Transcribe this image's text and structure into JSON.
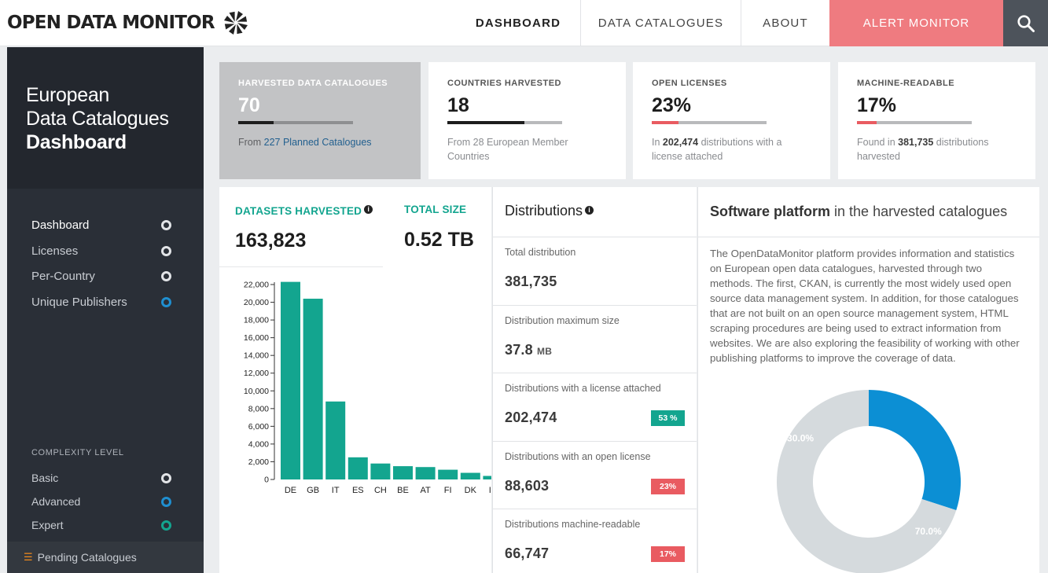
{
  "header": {
    "logo_text": "OPEN DATA MONITOR",
    "nav": [
      {
        "label": "DASHBOARD",
        "active": true
      },
      {
        "label": "DATA CATALOGUES"
      },
      {
        "label": "ABOUT"
      },
      {
        "label": "ALERT MONITOR"
      }
    ],
    "search_icon": "search-icon"
  },
  "sidebar": {
    "title_line1": "European",
    "title_line2": "Data Catalogues",
    "title_line3": "Dashboard",
    "menu": [
      {
        "label": "Dashboard",
        "active": true
      },
      {
        "label": "Licenses"
      },
      {
        "label": "Per-Country"
      },
      {
        "label": "Unique Publishers"
      }
    ],
    "complexity_title": "COMPLEXITY LEVEL",
    "complexity": [
      {
        "label": "Basic"
      },
      {
        "label": "Advanced"
      },
      {
        "label": "Expert"
      }
    ],
    "pending": "Pending Catalogues"
  },
  "kpis": [
    {
      "title": "HARVESTED DATA CATALOGUES",
      "value": "70",
      "progress": 0.31,
      "desc_prefix": "From ",
      "desc_link": "227 Planned Catalogues"
    },
    {
      "title": "COUNTRIES HARVESTED",
      "value": "18",
      "progress": 0.67,
      "desc": "From 28 European Member Countries"
    },
    {
      "title": "OPEN LICENSES",
      "value": "23%",
      "progress": 0.23,
      "desc_prefix": "In ",
      "desc_bold": "202,474",
      "desc_suffix": " distributions with a license attached"
    },
    {
      "title": "MACHINE-READABLE",
      "value": "17%",
      "progress": 0.17,
      "desc_prefix": "Found in ",
      "desc_bold": "381,735",
      "desc_suffix": " distributions harvested"
    }
  ],
  "datasets": {
    "title": "DATASETS HARVESTED",
    "value": "163,823",
    "total_size_title": "TOTAL SIZE",
    "total_size_value": "0.52 TB"
  },
  "distributions": {
    "title": "Distributions",
    "rows": [
      {
        "label": "Total distribution",
        "value": "381,735"
      },
      {
        "label": "Distribution maximum size",
        "value": "37.8",
        "unit": "MB"
      },
      {
        "label": "Distributions with a license attached",
        "value": "202,474",
        "badge": "53 %",
        "badge_color": "#13a58f"
      },
      {
        "label": "Distributions with an open license",
        "value": "88,603",
        "badge": "23%",
        "badge_color": "#e95b61"
      },
      {
        "label": "Distributions machine-readable",
        "value": "66,747",
        "badge": "17%",
        "badge_color": "#e95b61"
      }
    ]
  },
  "software": {
    "title_bold": "Software platform",
    "title_rest": " in the harvested catalogues",
    "text": "The OpenDataMonitor platform provides information and statistics on European open data catalogues, harvested through two methods. The first, CKAN, is currently the most widely used open source data management system. In addition, for those catalogues that are not built on an open source management system, HTML scraping procedures are being used to extract information from websites. We are also exploring the feasibility of working with other publishing platforms to improve the coverage of data."
  },
  "chart_data": [
    {
      "type": "bar",
      "categories": [
        "DE",
        "GB",
        "IT",
        "ES",
        "CH",
        "BE",
        "AT",
        "FI",
        "DK",
        "IE"
      ],
      "values": [
        22300,
        20400,
        8800,
        2500,
        1800,
        1500,
        1400,
        1100,
        750,
        400
      ],
      "yticks": [
        "0",
        "2,000",
        "4,000",
        "6,000",
        "8,000",
        "10,000",
        "12,000",
        "14,000",
        "16,000",
        "18,000",
        "20,000",
        "22,000"
      ],
      "ylim": [
        0,
        22000
      ],
      "color": "#13a58f"
    },
    {
      "type": "pie",
      "labels": [
        "30.0%",
        "70.0%"
      ],
      "values": [
        30.0,
        70.0
      ],
      "colors": [
        "#0c8fd4",
        "#d5dadd"
      ]
    }
  ],
  "colors": {
    "teal": "#13a58f",
    "red": "#e95b61",
    "blue": "#0c8fd4",
    "alert": "#ef7b80"
  }
}
